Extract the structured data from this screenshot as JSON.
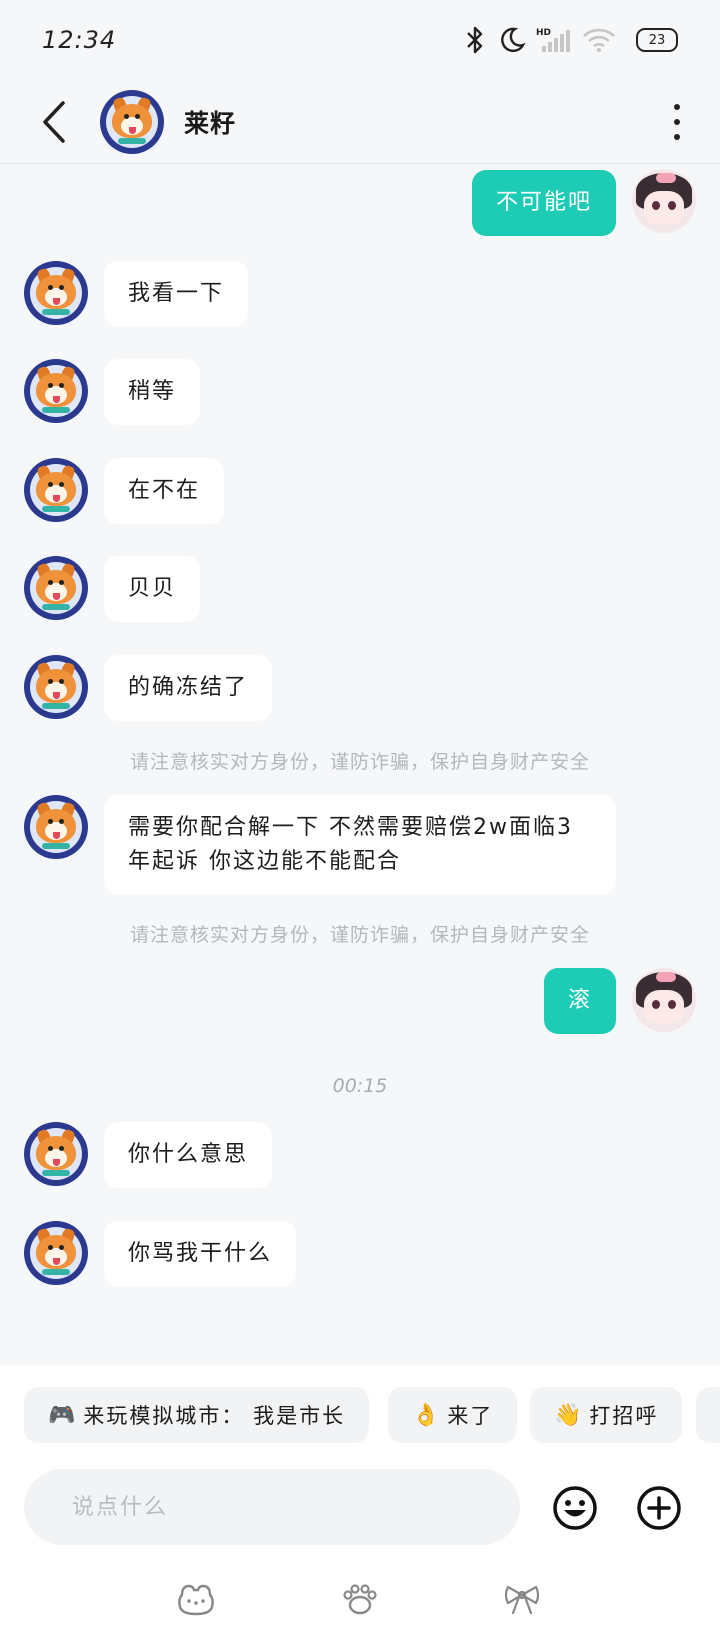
{
  "status_bar": {
    "time": "12:34",
    "battery": "23",
    "icons": [
      "bluetooth-icon",
      "moon-icon",
      "signal-icon",
      "wifi-icon",
      "battery-icon"
    ]
  },
  "header": {
    "contact_name": "莱籽",
    "back_icon": "back-arrow-icon",
    "more_icon": "more-vertical-icon"
  },
  "messages": [
    {
      "from": "me",
      "text": "不可能吧"
    },
    {
      "from": "them",
      "text": "我看一下"
    },
    {
      "from": "them",
      "text": "稍等"
    },
    {
      "from": "them",
      "text": "在不在"
    },
    {
      "from": "them",
      "text": "贝贝"
    },
    {
      "from": "them",
      "text": "的确冻结了"
    },
    {
      "from": "system",
      "text": "请注意核实对方身份，谨防诈骗，保护自身财产安全"
    },
    {
      "from": "them",
      "text": "需要你配合解一下 不然需要赔偿2w面临3年起诉 你这边能不能配合"
    },
    {
      "from": "system",
      "text": "请注意核实对方身份，谨防诈骗，保护自身财产安全"
    },
    {
      "from": "me",
      "text": "滚"
    },
    {
      "from": "timestamp",
      "text": "00:15"
    },
    {
      "from": "them",
      "text": "你什么意思"
    },
    {
      "from": "them",
      "text": "你骂我干什么"
    }
  ],
  "quick_replies": [
    {
      "emoji": "🎮",
      "label": "来玩模拟城市： 我是市长"
    },
    {
      "emoji": "👌",
      "label": "来了"
    },
    {
      "emoji": "👋",
      "label": "打招呼"
    }
  ],
  "composer": {
    "placeholder": "说点什么",
    "emoji_icon": "smiley-icon",
    "plus_icon": "plus-circle-icon"
  },
  "tab_bar": {
    "icons": [
      "frog-face-icon",
      "paw-icon",
      "bow-icon"
    ]
  },
  "colors": {
    "accent": "#1ecbb4",
    "background": "#f6f7f9",
    "bubble": "#ffffff",
    "notice": "#b4b7bd"
  }
}
